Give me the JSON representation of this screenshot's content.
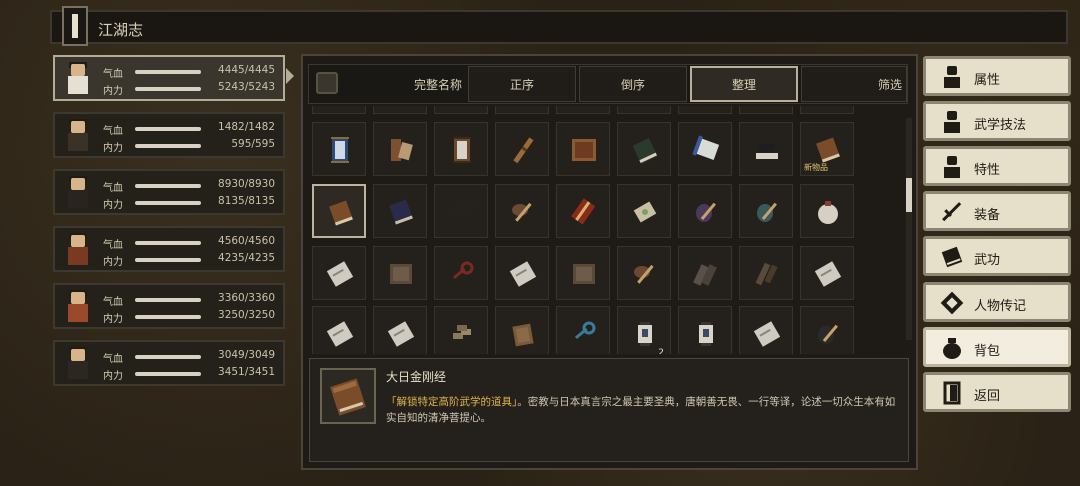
{
  "header": {
    "title": "江湖志"
  },
  "characters": [
    {
      "hp_label": "气血",
      "mp_label": "内力",
      "hp": "4445/4445",
      "mp": "5243/5243",
      "hp_fill": 1.0,
      "mp_fill": 1.0
    },
    {
      "hp_label": "气血",
      "mp_label": "内力",
      "hp": "1482/1482",
      "mp": "595/595",
      "hp_fill": 1.0,
      "mp_fill": 1.0
    },
    {
      "hp_label": "气血",
      "mp_label": "内力",
      "hp": "8930/8930",
      "mp": "8135/8135",
      "hp_fill": 1.0,
      "mp_fill": 1.0
    },
    {
      "hp_label": "气血",
      "mp_label": "内力",
      "hp": "4560/4560",
      "mp": "4235/4235",
      "hp_fill": 1.0,
      "mp_fill": 1.0
    },
    {
      "hp_label": "气血",
      "mp_label": "内力",
      "hp": "3360/3360",
      "mp": "3250/3250",
      "hp_fill": 1.0,
      "mp_fill": 1.0
    },
    {
      "hp_label": "气血",
      "mp_label": "内力",
      "hp": "3049/3049",
      "mp": "3451/3451",
      "hp_fill": 1.0,
      "mp_fill": 1.0
    }
  ],
  "tabs": {
    "full_name": "完整名称",
    "ascending": "正序",
    "descending": "倒序",
    "organize": "整理",
    "filter": "筛选"
  },
  "inventory": {
    "rows": [
      [
        {
          "icon": "scroll-blue-icon"
        },
        {
          "icon": "scroll-bundle-icon"
        },
        {
          "icon": "scroll-framed-icon"
        },
        {
          "icon": "flute-icon"
        },
        {
          "icon": "map-icon"
        },
        {
          "icon": "book-dark-green-icon"
        },
        {
          "icon": "scroll-blue-open-icon"
        },
        {
          "icon": "tea-set-icon"
        },
        {
          "icon": "book-brown-icon",
          "tag": "新物品"
        }
      ],
      [
        {
          "icon": "book-brown-icon",
          "selected": true
        },
        {
          "icon": "book-navy-icon"
        },
        {
          "icon": "key-dark-icon"
        },
        {
          "icon": "medicine-bowl-icon"
        },
        {
          "icon": "red-book-icon"
        },
        {
          "icon": "jade-talisman-icon"
        },
        {
          "icon": "purple-pot-icon"
        },
        {
          "icon": "teal-pot-icon"
        },
        {
          "icon": "pouch-icon"
        }
      ],
      [
        {
          "icon": "paper-icon"
        },
        {
          "icon": "tattered-map-icon"
        },
        {
          "icon": "key-red-icon"
        },
        {
          "icon": "paper-icon"
        },
        {
          "icon": "tattered-map-icon"
        },
        {
          "icon": "medicine-bowl-icon"
        },
        {
          "icon": "cloth-bundle-icon"
        },
        {
          "icon": "broken-blade-icon"
        },
        {
          "icon": "paper-icon"
        }
      ],
      [
        {
          "icon": "paper-icon"
        },
        {
          "icon": "paper-icon"
        },
        {
          "icon": "ingots-icon"
        },
        {
          "icon": "wooden-box-icon"
        },
        {
          "icon": "key-blue-icon"
        },
        {
          "icon": "lantern-icon",
          "count": "2"
        },
        {
          "icon": "lantern-icon"
        },
        {
          "icon": "paper-icon"
        },
        {
          "icon": "dark-pot-icon"
        }
      ]
    ]
  },
  "detail": {
    "title": "大日金刚经",
    "highlight": "「解锁特定高阶武学的道具」",
    "description": "。密教与日本真言宗之最主要圣典，唐朝善无畏、一行等译，论述一切众生本有如实自知的清净菩提心。"
  },
  "menu": [
    {
      "label": "属性",
      "icon": "person-icon"
    },
    {
      "label": "武学技法",
      "icon": "person-aura-icon"
    },
    {
      "label": "特性",
      "icon": "person-icon"
    },
    {
      "label": "装备",
      "icon": "sword-icon"
    },
    {
      "label": "武功",
      "icon": "book-icon"
    },
    {
      "label": "人物传记",
      "icon": "sword-book-icon"
    },
    {
      "label": "背包",
      "icon": "bag-icon",
      "active": true
    },
    {
      "label": "返回",
      "icon": "door-icon"
    }
  ],
  "colors": {
    "highlight": "#e0b24a",
    "accent": "#bcb49c",
    "menu_bg": "#e6dfca"
  }
}
